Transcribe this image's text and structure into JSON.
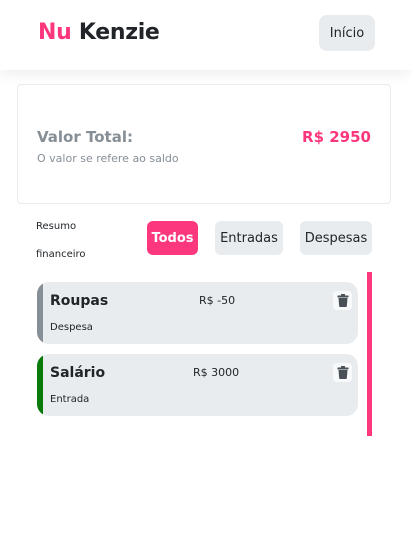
{
  "header": {
    "logo_part1": "Nu",
    "logo_part2": "Kenzie",
    "home_label": "Início"
  },
  "summary": {
    "label": "Valor Total:",
    "value": "R$ 2950",
    "description": "O valor se refere ao saldo"
  },
  "filters": {
    "title": "Resumo financeiro",
    "options": [
      {
        "label": "Todos",
        "active": true
      },
      {
        "label": "Entradas",
        "active": false
      },
      {
        "label": "Despesas",
        "active": false
      }
    ]
  },
  "transactions": [
    {
      "title": "Roupas",
      "value": "R$ -50",
      "type": "Despesa",
      "color": "#868e96"
    },
    {
      "title": "Salário",
      "value": "R$ 3000",
      "type": "Entrada",
      "color": "#03b898"
    }
  ],
  "colors": {
    "brand": "#fd377e",
    "expense": "#868e96",
    "income": "#0a7b0a",
    "grey_bg": "#e9ecef"
  },
  "icons": {
    "delete": "trash-icon"
  }
}
